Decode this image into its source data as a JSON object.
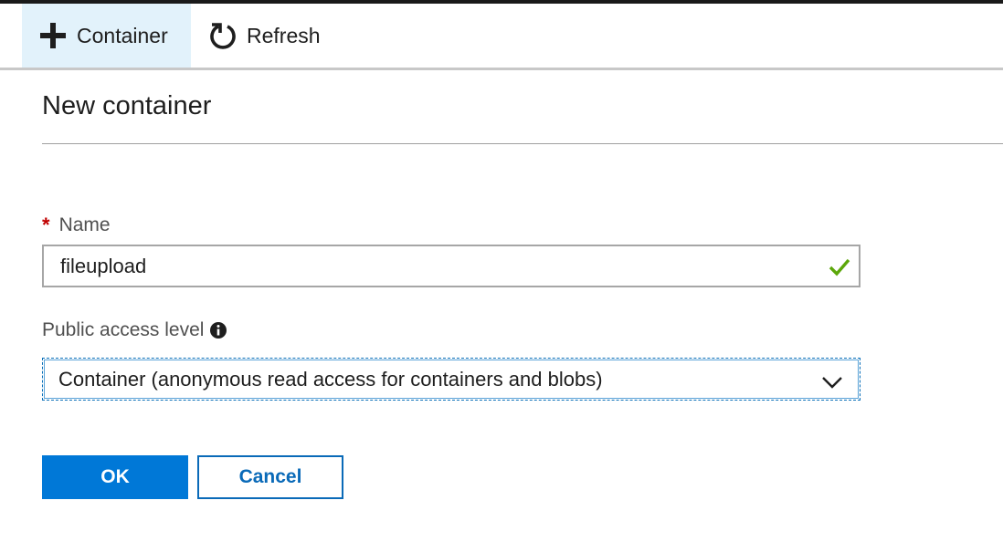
{
  "toolbar": {
    "add_container_label": "Container",
    "refresh_label": "Refresh"
  },
  "panel": {
    "title": "New container"
  },
  "form": {
    "name": {
      "required_marker": "*",
      "label": "Name",
      "value": "fileupload",
      "valid": true
    },
    "public_access": {
      "label": "Public access level",
      "selected": "Container (anonymous read access for containers and blobs)"
    }
  },
  "actions": {
    "ok_label": "OK",
    "cancel_label": "Cancel"
  },
  "colors": {
    "primary": "#0078d7",
    "toolbar_active_bg": "#e2f2fb",
    "valid_check": "#5ca70a",
    "required": "#c00000"
  },
  "icons": {
    "add": "plus-icon",
    "refresh": "refresh-icon",
    "info": "info-icon",
    "valid": "checkmark-icon",
    "dropdown": "chevron-down-icon"
  }
}
